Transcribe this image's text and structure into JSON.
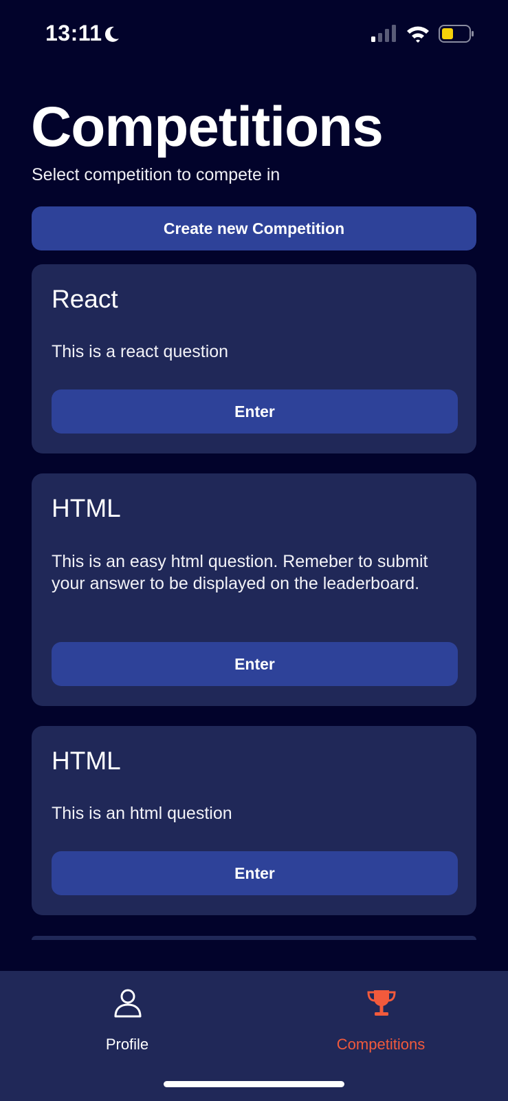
{
  "status_bar": {
    "time": "13:11",
    "icons": [
      "moon-icon",
      "cellular-signal-icon",
      "wifi-icon",
      "battery-icon"
    ],
    "battery_color": "#f5d10a"
  },
  "header": {
    "title": "Competitions",
    "subtitle": "Select competition to compete in"
  },
  "create_button": {
    "label": "Create new Competition"
  },
  "competitions": [
    {
      "title": "React",
      "description": "This is a react question",
      "button": "Enter"
    },
    {
      "title": "HTML",
      "description": "This is an easy html question. Remeber to submit your answer to be displayed on the leaderboard.",
      "button": "Enter"
    },
    {
      "title": "HTML",
      "description": "This is an html question",
      "button": "Enter"
    }
  ],
  "tab_bar": {
    "items": [
      {
        "label": "Profile",
        "icon": "person-icon",
        "active": false
      },
      {
        "label": "Competitions",
        "icon": "trophy-icon",
        "active": true
      }
    ],
    "active_color": "#f25a3c"
  },
  "colors": {
    "background": "#02032b",
    "card": "#202858",
    "button": "#2e4299"
  }
}
